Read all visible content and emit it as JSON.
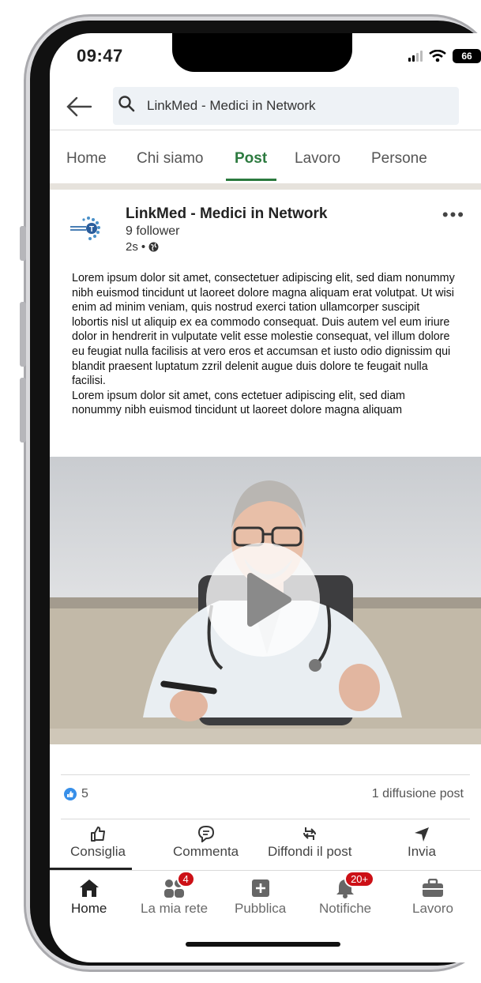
{
  "status_bar": {
    "time": "09:47",
    "battery": "66"
  },
  "search": {
    "value": "LinkMed - Medici in Network"
  },
  "tabs": [
    {
      "label": "Home"
    },
    {
      "label": "Chi siamo"
    },
    {
      "label": "Post"
    },
    {
      "label": "Lavoro"
    },
    {
      "label": "Persone"
    }
  ],
  "active_tab": "Post",
  "post": {
    "author": "LinkMed - Medici in Network",
    "followers": "9 follower",
    "time": "2s",
    "text": [
      "Lorem ipsum dolor sit amet, consectetuer adipiscing elit, sed diam nonummy nibh euismod tincidunt ut laoreet dolore magna aliquam erat volutpat. Ut wisi enim ad minim veniam, quis nostrud exerci tation ullamcorper suscipit lobortis nisl ut aliquip ex ea commodo consequat. Duis autem vel eum iriure dolor in hendrerit in vulputate velit esse molestie consequat, vel illum dolore eu feugiat nulla facilisis at vero eros et accumsan et iusto odio dignissim qui blandit praesent luptatum zzril delenit augue duis dolore te feugait nulla facilisi.",
      "Lorem ipsum dolor sit amet, cons ectetuer adipiscing elit, sed diam nonummy nibh euismod tincidunt ut laoreet dolore magna aliquam"
    ],
    "reactions_count": "5",
    "shares": "1 diffusione post"
  },
  "actions": [
    {
      "label": "Consiglia",
      "icon": "thumbs-up-icon"
    },
    {
      "label": "Commenta",
      "icon": "comment-icon"
    },
    {
      "label": "Diffondi il post",
      "icon": "repost-icon"
    },
    {
      "label": "Invia",
      "icon": "send-icon"
    }
  ],
  "bottom_nav": [
    {
      "label": "Home",
      "icon": "home-icon"
    },
    {
      "label": "La mia rete",
      "icon": "network-icon",
      "badge": "4"
    },
    {
      "label": "Pubblica",
      "icon": "plus-icon"
    },
    {
      "label": "Notifiche",
      "icon": "bell-icon",
      "badge": "20+"
    },
    {
      "label": "Lavoro",
      "icon": "briefcase-icon"
    }
  ],
  "colors": {
    "accent_green": "#2c7a3f",
    "like_blue": "#378fe9",
    "badge_red": "#cc1016"
  }
}
